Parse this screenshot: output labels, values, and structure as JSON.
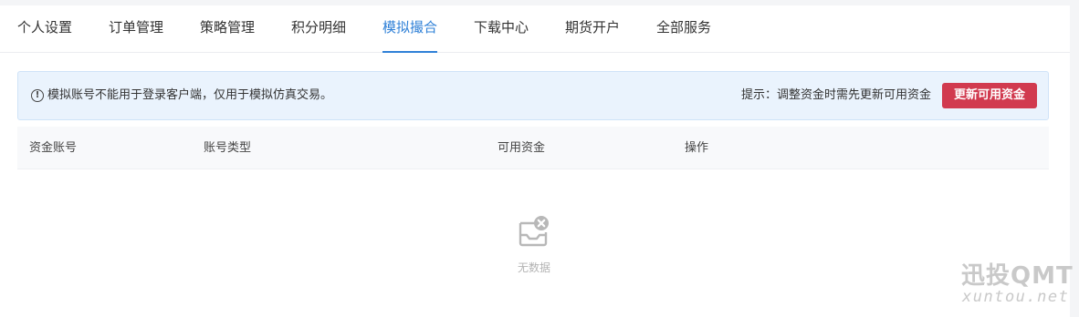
{
  "tabs": [
    {
      "label": "个人设置",
      "active": false
    },
    {
      "label": "订单管理",
      "active": false
    },
    {
      "label": "策略管理",
      "active": false
    },
    {
      "label": "积分明细",
      "active": false
    },
    {
      "label": "模拟撮合",
      "active": true
    },
    {
      "label": "下载中心",
      "active": false
    },
    {
      "label": "期货开户",
      "active": false
    },
    {
      "label": "全部服务",
      "active": false
    }
  ],
  "notice": {
    "icon": "info-circle-icon",
    "text": "模拟账号不能用于登录客户端，仅用于模拟仿真交易。",
    "hint": "提示：调整资金时需先更新可用资金",
    "button_label": "更新可用资金"
  },
  "table": {
    "columns": [
      "资金账号",
      "账号类型",
      "可用资金",
      "操作"
    ],
    "rows": []
  },
  "empty": {
    "icon": "empty-inbox-icon",
    "text": "无数据"
  },
  "watermark": {
    "title": "迅投QMT",
    "url": "xuntou.net"
  },
  "colors": {
    "accent": "#2f80d7",
    "button": "#d13a4f",
    "notice_bg": "#eaf3fd"
  }
}
